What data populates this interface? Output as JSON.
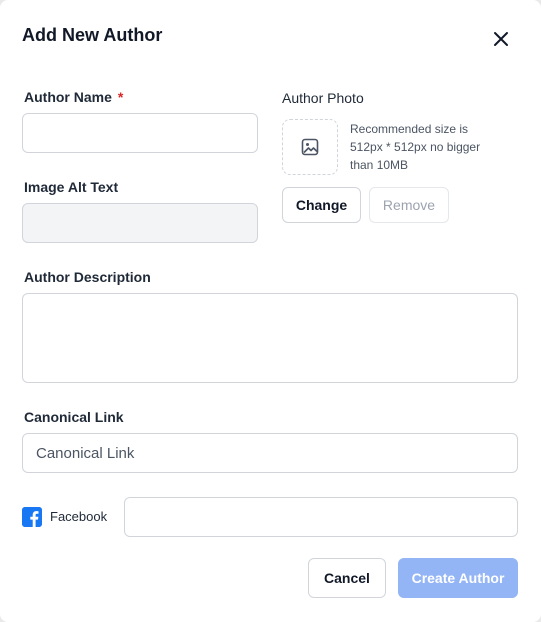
{
  "dialog": {
    "title": "Add New Author",
    "close_icon": "close-icon"
  },
  "form": {
    "author_name": {
      "label": "Author Name",
      "required_mark": "*",
      "value": ""
    },
    "image_alt_text": {
      "label": "Image Alt Text",
      "value": ""
    },
    "author_photo": {
      "label": "Author Photo",
      "icon": "image-icon",
      "hint": "Recommended size is 512px * 512px no bigger than 10MB",
      "change_label": "Change",
      "remove_label": "Remove"
    },
    "author_description": {
      "label": "Author Description",
      "value": ""
    },
    "canonical_link": {
      "label": "Canonical Link",
      "placeholder": "Canonical Link",
      "value": ""
    },
    "facebook": {
      "label": "Facebook",
      "icon": "facebook-icon",
      "value": ""
    }
  },
  "actions": {
    "cancel_label": "Cancel",
    "create_label": "Create Author"
  },
  "colors": {
    "primary_disabled": "#93b4f5",
    "required": "#dc2626",
    "facebook": "#1877f2"
  }
}
